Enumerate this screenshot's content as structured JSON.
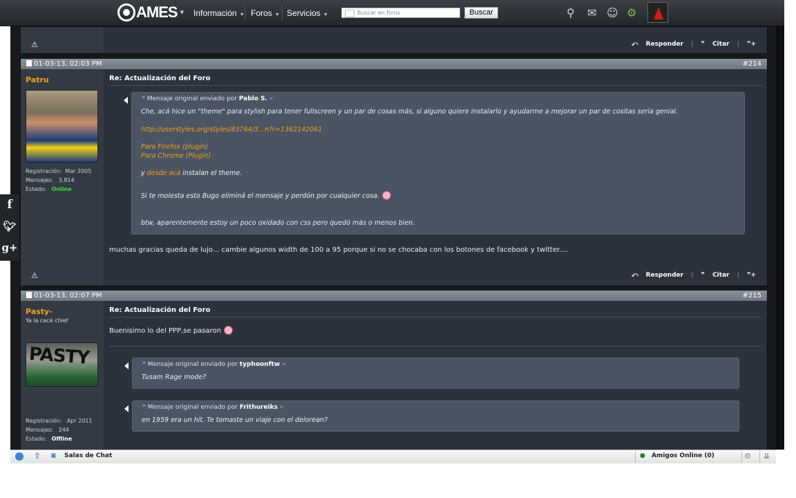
{
  "topbar": {
    "logo_text": "AMES",
    "menu": [
      "Información",
      "Foros",
      "Servicios"
    ],
    "search_placeholder": "Buscar en foros",
    "search_button": "Buscar",
    "icons": [
      "satellite-icon",
      "mail-icon",
      "people-icon",
      "gears-icon"
    ]
  },
  "actions": {
    "reply": "Responder",
    "quote": "Citar"
  },
  "post_prev": {},
  "post214": {
    "date": "01-03-13, 02:03 PM",
    "number": "#214",
    "username": "Patru",
    "stats": {
      "reg_label": "Registración:",
      "reg_value": "Mar 2005",
      "msg_label": "Mensajes:",
      "msg_value": "3,814",
      "state_label": "Estado:",
      "state_value": "Online"
    },
    "title": "Re: Actualización del Foro",
    "quote": {
      "header_prefix": "Mensaje original enviado por",
      "author": "Pablo S.",
      "line1": "Che, acá hice un \"theme\" para stylish para tener fullscreen y un par de cosas más, si alguno quiere instalarlo y ayudarme a mejorar un par de cositas sería genial.",
      "link": "http://userstyles.org/styles/83764/3...n?r=1362142061",
      "ff": "Para Firefox (plugin)",
      "chrome": "Para Chrome (Plugin)",
      "install_pre": "y",
      "install_link": "desde acá",
      "install_post": "instalan el theme.",
      "bugo": "Si te molesta esto Bugo eliminá el mensaje y perdón por cualquier cosa.",
      "btw": "btw, aparentemente estoy un poco oxidado con css pero quedó más o menos bien."
    },
    "body": "muchas gracias queda de lujo... cambie algunos width de 100 a 95 porque si no se chocaba con los botones de facebook y twitter...."
  },
  "post215": {
    "date": "01-03-13, 02:07 PM",
    "number": "#215",
    "username": "Pasty-",
    "user_title": "Ya la cacé chief",
    "avatar_text": "PASTY",
    "stats": {
      "reg_label": "Registración:",
      "reg_value": "Apr 2011",
      "msg_label": "Mensajes:",
      "msg_value": "244",
      "state_label": "Estado:",
      "state_value": "Offline"
    },
    "title": "Re: Actualización del Foro",
    "body": "Buenisimo lo del PPP,se pasaron",
    "quote1": {
      "header_prefix": "Mensaje original enviado por",
      "author": "typhoonftw",
      "text": "Tusam Rage mode?"
    },
    "quote2": {
      "header_prefix": "Mensaje original enviado por",
      "author": "Frithureiks",
      "text": "en 1959 era un hit. Te tomaste un viaje con el delorean?"
    }
  },
  "bottombar": {
    "chat": "Salas de Chat",
    "friends": "Amigos Online (0)"
  },
  "colors": {
    "accent": "#f0a020",
    "online": "#3ddc3d"
  }
}
